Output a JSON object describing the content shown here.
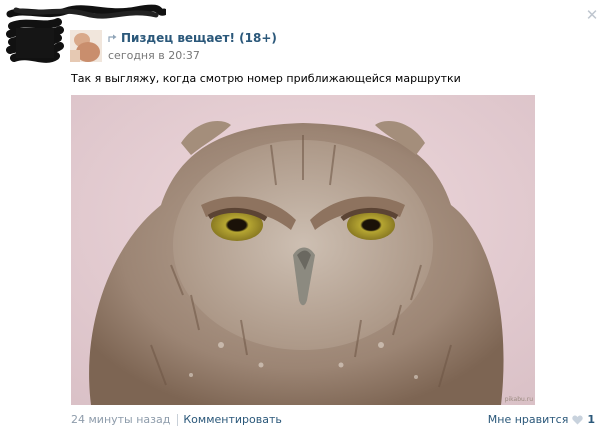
{
  "post": {
    "group_name": "Пиздец вещает! (18+)",
    "time": "сегодня в 20:37",
    "text": "Так я выгляжу, когда смотрю номер приближающейся маршрутки",
    "photo_subject": "owl-photo",
    "watermark": "pikabu.ru"
  },
  "footer": {
    "ago": "24 минуты назад",
    "comment_label": "Комментировать",
    "like_label": "Мне нравится",
    "like_count": "1"
  },
  "icons": {
    "close": "close-icon",
    "share": "share-arrow-icon",
    "heart": "heart-icon"
  },
  "colors": {
    "link": "#2b587a",
    "muted": "#777777",
    "footer_muted": "#8e9cab",
    "close": "#bfc6cf",
    "heart": "#c8d2dd"
  }
}
